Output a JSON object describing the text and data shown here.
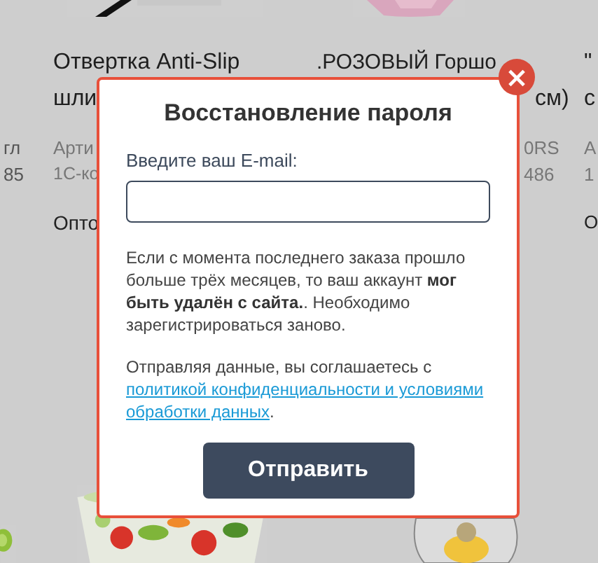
{
  "background": {
    "columns": [
      {
        "meta_lines": [
          "гл",
          "85"
        ]
      },
      {
        "title_lines": [
          "Отвертка Anti-Slip",
          "шли"
        ],
        "meta_lines": [
          "Арти",
          "1С-ко"
        ],
        "price_label": "Опто"
      },
      {
        "title_lines": [
          ".РОЗОВЫЙ Горшо",
          "см)"
        ],
        "meta_lines": [
          "0RS",
          "486"
        ]
      },
      {
        "title_lines": [
          "\"",
          "с"
        ],
        "meta_lines": [
          "А",
          "1"
        ],
        "price_label": "О"
      }
    ]
  },
  "dialog": {
    "title": "Восстановление пароля",
    "close": "×",
    "email": {
      "label": "Введите ваш E-mail:"
    },
    "notice": "Если с момента последнего заказа прошло больше трёх месяцев, то ваш аккаунт **мог быть удалён с сайта.**. Необходимо зарегистрироваться заново.",
    "consent": {
      "text": "Отправляя данные, вы соглашаетесь с",
      "link_lines": [
        "политикой конфиденциальности и условиями",
        "обработки данных"
      ],
      "end": "."
    },
    "submit": "Отправить"
  }
}
